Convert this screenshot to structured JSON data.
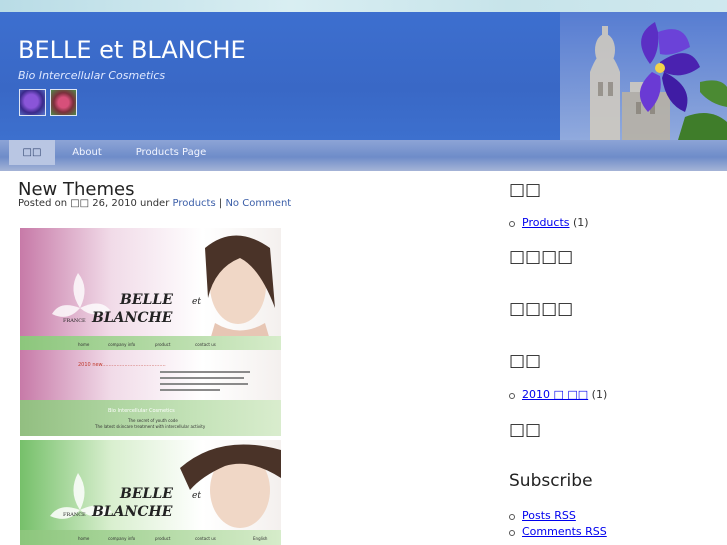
{
  "site": {
    "title": "BELLE et BLANCHE",
    "tagline": "Bio Intercellular Cosmetics",
    "thumbnails": [
      "purple-flower-thumbnail",
      "red-flower-thumbnail"
    ]
  },
  "nav": {
    "items": [
      {
        "label": "□□",
        "active": true
      },
      {
        "label": "About",
        "active": false
      },
      {
        "label": "Products Page",
        "active": false
      }
    ]
  },
  "post": {
    "title": "New Themes",
    "meta_prefix": "Posted on □□ 26, 2010 under",
    "category": "Products",
    "separator": "|",
    "comments": "No Comment",
    "image": {
      "panel1": {
        "brand1": "BELLE",
        "et": "et",
        "france": "FRANCE",
        "brand2": "BLANCHE",
        "menu": [
          "home",
          "company info",
          "product",
          "contact us"
        ],
        "headline": "2010 new........................................",
        "subtitle": "Bio  Intercellular  Cosmetics",
        "slogan1": "The secret of youth code",
        "slogan2": "The latest skincare treatment with intercellular activity"
      },
      "panel2": {
        "brand1": "BELLE",
        "et": "et",
        "france": "FRANCE",
        "brand2": "BLANCHE",
        "menu": [
          "home",
          "company info",
          "product",
          "contact us",
          "English"
        ]
      }
    }
  },
  "sidebar": {
    "widgets": [
      {
        "title": "□□",
        "items": [
          {
            "label": "Products",
            "count": "(1)"
          }
        ]
      },
      {
        "title": "□□□□",
        "items": []
      },
      {
        "title": "□□□□",
        "items": []
      },
      {
        "title": "□□",
        "items": [
          {
            "label": "2010 □ □□",
            "count": "(1)"
          }
        ]
      },
      {
        "title": "□□",
        "items": []
      },
      {
        "title": "Subscribe",
        "items": [
          {
            "label": "Posts RSS",
            "count": ""
          },
          {
            "label": "Comments RSS",
            "count": ""
          }
        ]
      }
    ]
  },
  "colors": {
    "header_blue": "#3968c6",
    "link": "#3b5ea8",
    "nav_active": "#b9c6e3"
  }
}
